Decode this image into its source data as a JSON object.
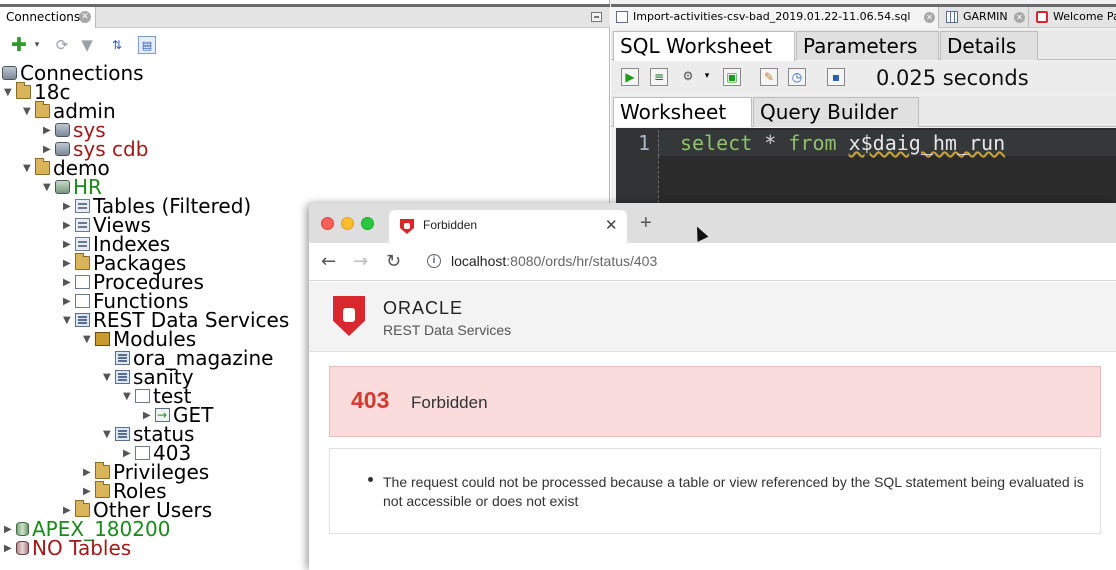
{
  "connections_panel": {
    "tab_label": "Connections",
    "tree": [
      {
        "label": "Connections",
        "icon": "connections-icon"
      },
      {
        "label": "18c",
        "icon": "folder-icon"
      },
      {
        "label": "admin",
        "icon": "folder-icon"
      },
      {
        "label": "sys",
        "icon": "connection-icon",
        "color": "#a11a1a"
      },
      {
        "label": "sys cdb",
        "icon": "connection-icon",
        "color": "#a11a1a"
      },
      {
        "label": "demo",
        "icon": "folder-icon"
      },
      {
        "label": "HR",
        "icon": "connection-icon",
        "color": "#1b8a1b"
      },
      {
        "label": "Tables (Filtered)",
        "icon": "tables-icon"
      },
      {
        "label": "Views",
        "icon": "views-icon"
      },
      {
        "label": "Indexes",
        "icon": "indexes-icon"
      },
      {
        "label": "Packages",
        "icon": "packages-icon"
      },
      {
        "label": "Procedures",
        "icon": "procedures-icon"
      },
      {
        "label": "Functions",
        "icon": "functions-icon"
      },
      {
        "label": "REST Data Services",
        "icon": "rest-icon"
      },
      {
        "label": "Modules",
        "icon": "module-icon"
      },
      {
        "label": "ora_magazine",
        "icon": "rest-module-icon"
      },
      {
        "label": "sanity",
        "icon": "rest-module-icon"
      },
      {
        "label": "test",
        "icon": "template-icon"
      },
      {
        "label": "GET",
        "icon": "handler-icon"
      },
      {
        "label": "status",
        "icon": "rest-module-icon"
      },
      {
        "label": "403",
        "icon": "template-icon"
      },
      {
        "label": "Privileges",
        "icon": "privileges-icon"
      },
      {
        "label": "Roles",
        "icon": "roles-icon"
      },
      {
        "label": "Other Users",
        "icon": "users-icon"
      },
      {
        "label": "APEX_180200",
        "icon": "database-icon",
        "color": "#1b8a1b"
      },
      {
        "label": "NO Tables",
        "icon": "database-icon",
        "color": "#a11a1a"
      }
    ]
  },
  "editor": {
    "doc_tabs": [
      {
        "label": "Import-activities-csv-bad_2019.01.22-11.06.54.sql",
        "icon": "sql-file-icon"
      },
      {
        "label": "GARMIN",
        "icon": "grid-icon"
      },
      {
        "label": "Welcome Pa",
        "icon": "oracle-icon"
      }
    ],
    "editor_tabs": [
      "SQL Worksheet",
      "Parameters",
      "Details"
    ],
    "elapsed": "0.025 seconds",
    "sub_tabs": [
      "Worksheet",
      "Query Builder"
    ],
    "code": {
      "line_number": "1",
      "kw1": "select",
      "op": " * ",
      "kw2": "from",
      "space": " ",
      "object": "x$daig_hm_run"
    }
  },
  "browser": {
    "tab_title": "Forbidden",
    "new_tab": "+",
    "url_host": "localhost",
    "url_rest": ":8080/ords/hr/status/403",
    "brand": "ORACLE",
    "brand_sub": "REST Data Services",
    "error_code": "403",
    "error_text": "Forbidden",
    "detail": "The request could not be processed because a table or view referenced by the SQL statement being evaluated is not accessible or does not exist",
    "colors": {
      "oracle_red": "#d9272e",
      "error_bg": "#f9dcdb",
      "error_code": "#d33a2f"
    }
  }
}
